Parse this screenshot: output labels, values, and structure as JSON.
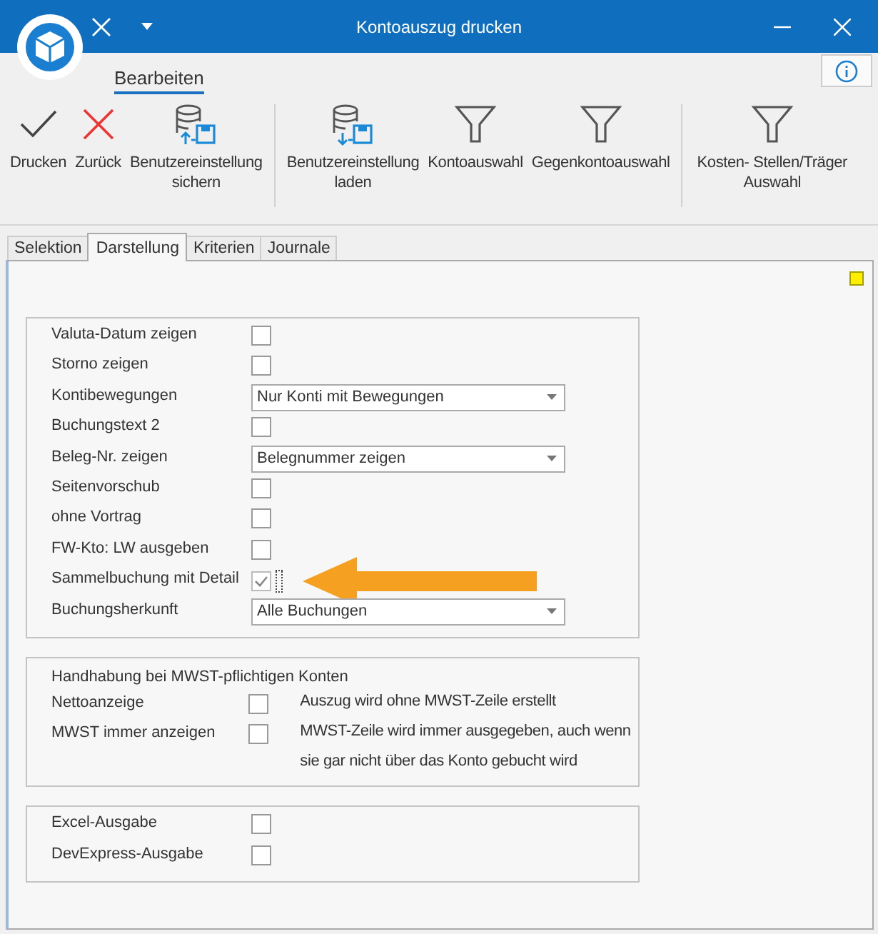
{
  "window": {
    "title": "Kontoauszug drucken"
  },
  "ribbon": {
    "tabs": [
      {
        "label": "Bearbeiten",
        "selected": true
      }
    ],
    "groups": [
      {
        "buttons": [
          {
            "label": "Drucken",
            "kind": "check"
          },
          {
            "label": "Zurück",
            "kind": "cross"
          },
          {
            "label": "Benutzereinstellung\nsichern",
            "kind": "save"
          }
        ]
      },
      {
        "buttons": [
          {
            "label": "Benutzereinstellung\nladen",
            "kind": "load"
          },
          {
            "label": "Kontoauswahl",
            "kind": "filter"
          },
          {
            "label": "Gegenkontoauswahl",
            "kind": "filter"
          }
        ]
      },
      {
        "buttons": [
          {
            "label": "Kosten- Stellen/Träger\nAuswahl",
            "kind": "filter"
          }
        ]
      }
    ]
  },
  "tabs": [
    {
      "label": "Selektion",
      "selected": false
    },
    {
      "label": "Darstellung",
      "selected": true
    },
    {
      "label": "Kriterien",
      "selected": false
    },
    {
      "label": "Journale",
      "selected": false
    }
  ],
  "groups": [
    {
      "rows": [
        {
          "label": "Valuta-Datum zeigen",
          "kind": "checkbox",
          "checked": false
        },
        {
          "label": "Storno zeigen",
          "kind": "checkbox",
          "checked": false
        },
        {
          "label": "Kontibewegungen",
          "kind": "dropdown",
          "value": "Nur Konti mit Bewegungen"
        },
        {
          "label": "Buchungstext 2",
          "kind": "checkbox",
          "checked": false
        },
        {
          "label": "Beleg-Nr. zeigen",
          "kind": "dropdown",
          "value": "Belegnummer zeigen"
        },
        {
          "label": "Seitenvorschub",
          "kind": "checkbox",
          "checked": false
        },
        {
          "label": "ohne Vortrag",
          "kind": "checkbox",
          "checked": false
        },
        {
          "label": "FW-Kto: LW ausgeben",
          "kind": "checkbox",
          "checked": false
        },
        {
          "label": "Sammelbuchung mit Detail",
          "kind": "checkbox",
          "checked": true,
          "focused": true
        },
        {
          "label": "Buchungsherkunft",
          "kind": "dropdown",
          "value": "Alle Buchungen"
        }
      ]
    },
    {
      "title": "Handhabung bei MWST-pflichtigen Konten",
      "rows": [
        {
          "label": "Nettoanzeige",
          "kind": "checkbox",
          "checked": false,
          "description": "Auszug wird ohne MWST-Zeile erstellt"
        },
        {
          "label": "MWST immer anzeigen",
          "kind": "checkbox",
          "checked": false,
          "description": "MWST-Zeile wird immer ausgegeben, auch wenn sie gar nicht über das Konto gebucht wird"
        }
      ]
    },
    {
      "rows": [
        {
          "label": "Excel-Ausgabe",
          "kind": "checkbox",
          "checked": false
        },
        {
          "label": "DevExpress-Ausgabe",
          "kind": "checkbox",
          "checked": false
        }
      ]
    }
  ]
}
